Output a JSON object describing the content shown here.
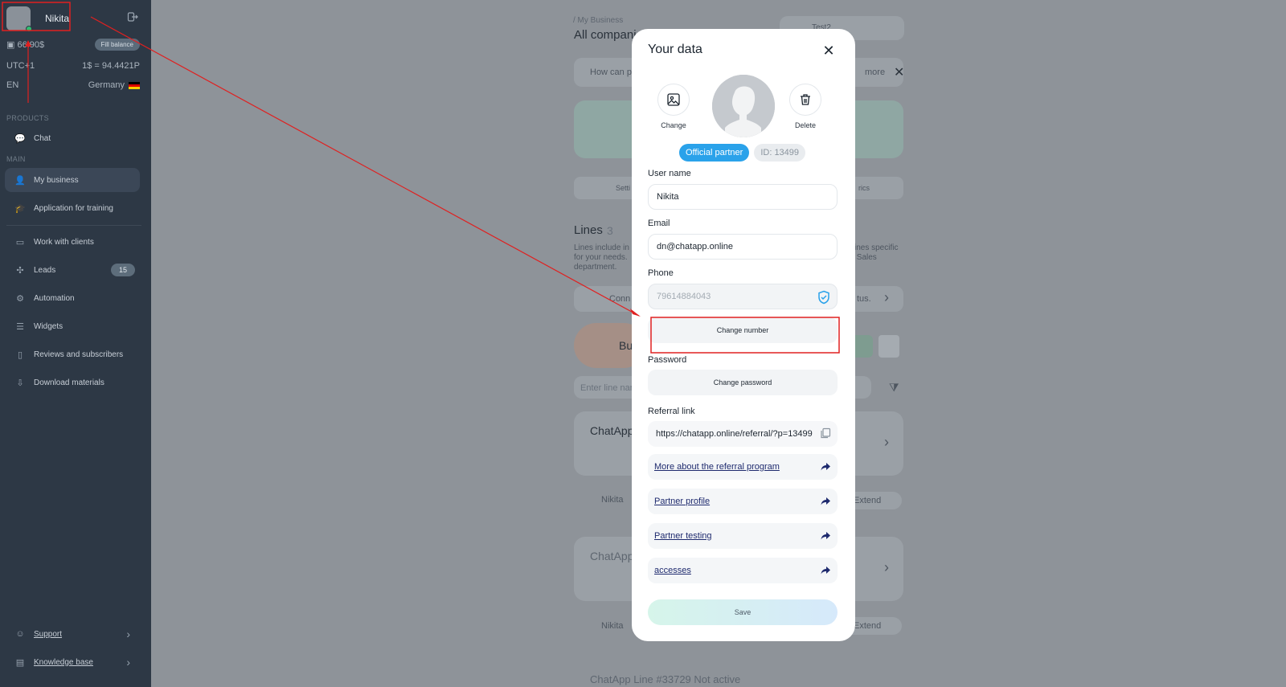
{
  "sidebar": {
    "user_name": "Nikita",
    "balance": "66.90$",
    "fill_balance": "Fill balance",
    "timezone": "UTC+1",
    "rate": "1$ = 94.4421P",
    "language": "EN",
    "country": "Germany",
    "sections": {
      "products": "PRODUCTS",
      "main": "MAIN"
    },
    "items": [
      {
        "label": "Chat",
        "icon": "chat-icon"
      },
      {
        "label": "My business",
        "icon": "business-icon"
      },
      {
        "label": "Application for training",
        "icon": "graduation-icon"
      },
      {
        "label": "Work with clients",
        "icon": "clients-icon"
      },
      {
        "label": "Leads",
        "icon": "leads-icon",
        "badge": "15"
      },
      {
        "label": "Automation",
        "icon": "automation-icon"
      },
      {
        "label": "Widgets",
        "icon": "widgets-icon"
      },
      {
        "label": "Reviews and subscribers",
        "icon": "reviews-icon"
      },
      {
        "label": "Download materials",
        "icon": "download-icon"
      }
    ],
    "footer": [
      {
        "label": "Support",
        "icon": "support-icon"
      },
      {
        "label": "Knowledge base",
        "icon": "book-icon"
      }
    ]
  },
  "background": {
    "breadcrumb": "/ My Business",
    "title": "All compani",
    "company": "Test2",
    "help_text": "How can p",
    "more": "more",
    "lines_title": "Lines",
    "lines_count": "3",
    "lines_desc_left": "Lines include in\nfor your needs.\ndepartment.",
    "lines_desc_right": "ines specific\n Sales",
    "settings_tab": "Setti",
    "metrics_tab": "rics",
    "connect": "Conn",
    "status_suffix": "tus.",
    "bu_label": "Bu",
    "line_search_placeholder": "Enter line nam",
    "chatapp1": "ChatApp",
    "chatapp2": "ChatApp",
    "row_user": "Nikita",
    "extend": "Extend",
    "bottom_line": "ChatApp Line #33729 Not active"
  },
  "modal": {
    "title": "Your data",
    "change_photo": "Change",
    "delete_photo": "Delete",
    "badge_partner": "Official partner",
    "badge_id": "ID: 13499",
    "user_name_label": "User name",
    "user_name_value": "Nikita",
    "email_label": "Email",
    "email_value": "dn@chatapp.online",
    "phone_label": "Phone",
    "phone_value": "79614884043",
    "change_number": "Change number",
    "password_label": "Password",
    "change_password": "Change password",
    "referral_label": "Referral link",
    "referral_value": "https://chatapp.online/referral/?p=13499",
    "links": [
      "More about the referral program",
      "Partner profile",
      "Partner testing",
      "accesses"
    ],
    "save": "Save"
  },
  "colors": {
    "sidebar_bg": "#2d3845",
    "partner_badge": "#2aa2ea",
    "annotation": "#e02020"
  }
}
